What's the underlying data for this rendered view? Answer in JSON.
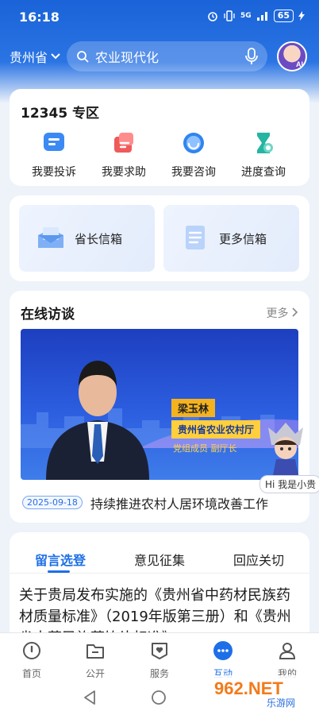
{
  "status": {
    "time": "16:18",
    "network": "5G",
    "battery": "65"
  },
  "header": {
    "region": "贵州省",
    "search_query": "农业现代化"
  },
  "zone": {
    "title": "12345 专区",
    "items": [
      {
        "label": "我要投诉",
        "icon": "chat-icon"
      },
      {
        "label": "我要求助",
        "icon": "help-icon"
      },
      {
        "label": "我要咨询",
        "icon": "headset-icon"
      },
      {
        "label": "进度查询",
        "icon": "hourglass-icon"
      }
    ]
  },
  "mailboxes": [
    {
      "label": "省长信箱",
      "icon": "mailbox-icon"
    },
    {
      "label": "更多信箱",
      "icon": "document-icon"
    }
  ],
  "interviews": {
    "title": "在线访谈",
    "more": "更多",
    "banner": {
      "name": "梁玉林",
      "position": "贵州省农业农村厅",
      "subtitle": "党组成员  副厅长"
    },
    "date": "2025-09-18",
    "headline": "持续推进农村人居环境改善工作",
    "mascot_text": "Hi 我是小贵"
  },
  "message_tabs": {
    "tabs": [
      "留言选登",
      "意见征集",
      "回应关切"
    ],
    "active": 0,
    "article": "关于贵局发布实施的《贵州省中药材民族药材质量标准》（2019年版第三册）和《贵州省中药民族药饮片标准》"
  },
  "bottom_nav": [
    {
      "label": "首页",
      "icon": "home-icon"
    },
    {
      "label": "公开",
      "icon": "folder-icon"
    },
    {
      "label": "服务",
      "icon": "heart-shield-icon"
    },
    {
      "label": "互动",
      "icon": "chat-bubble-icon"
    },
    {
      "label": "我的",
      "icon": "user-icon"
    }
  ],
  "watermark": {
    "brand": "962.NET",
    "sub": "乐游网"
  },
  "colors": {
    "primary": "#1d6fe8",
    "header": "#1a63d8"
  }
}
